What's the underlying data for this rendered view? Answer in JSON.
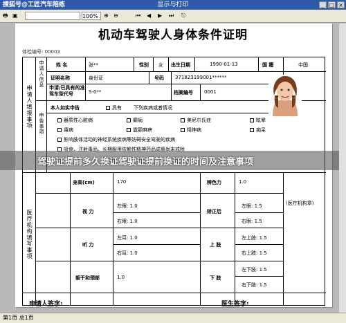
{
  "window": {
    "app_title": "搜狐号@工匠汽车陪练",
    "center_title": "显示与打印",
    "zoom": "100%"
  },
  "toolbar": {
    "close_icon": "close-icon"
  },
  "doc": {
    "title": "机动车驾驶人身体条件证明",
    "serial_label": "体检编号:",
    "serial_value": "00003",
    "section_applicant": "申请人填报事项",
    "section_medical": "医疗机构填写事项",
    "name_label": "姓  名",
    "name_value": "张**",
    "gender_label": "性别",
    "gender_value": "女",
    "dob_label": "出生日期",
    "dob_value": "1990-01-13",
    "nation_label": "国  籍",
    "nation_value": "中国",
    "id_type_label": "证明名称",
    "id_type_value": "身份证",
    "id_no_label": "号码",
    "id_no_value": "371823199001******",
    "license_label": "申请/已具有的准驾车型代号",
    "license_value": "S-0**",
    "archive_label": "档案编号",
    "archive_value": "0001",
    "declare_label": "本人如实申告",
    "declare_option": "具有",
    "declare_desc": "下列疾病或者情况",
    "declare_side": "申告事项",
    "conditions": [
      "器质性心脏病",
      "癫痫",
      "美尼尔氏症",
      "眩晕",
      "癔病",
      "震颤麻痹",
      "精神病",
      "痴呆",
      "影响肢体活动的神经系统疾病等妨碍安全驾驶的疾病",
      "吸食、注射毒品、长期服用依赖性精神药品成瘾尚未戒除"
    ],
    "height_label": "身高(cm)",
    "height_value": "170",
    "color_label": "辨色力",
    "color_value": "1.0",
    "org_stamp": "(医疗机构章)",
    "vision_label": "视  力",
    "vision_left": "左眼: 1.0",
    "vision_right": "右眼: 1.0",
    "corrected_label": "矫正后",
    "corrected_left": "左眼: 1.5",
    "corrected_right": "右眼: 1.5",
    "hearing_label": "听  力",
    "hearing_left": "左耳: 1.0",
    "hearing_right": "右耳: 1.0",
    "upper_label": "上  肢",
    "upper_left": "左上肢: 1.5",
    "upper_right": "右上肢: 1.5",
    "trunk_label": "躯干和颈部",
    "trunk_value": "1.0",
    "lower_label": "下  肢",
    "lower_left": "左下肢: 1.5",
    "lower_right": "右下肢: 1.5",
    "applicant_sign": "申请人签字:",
    "doctor_sign": "医生签字:"
  },
  "banner": {
    "text": "驾驶证提前多久换证驾驶证提前换证的时间及注意事项"
  },
  "status": {
    "left": "第1页 总1页"
  }
}
